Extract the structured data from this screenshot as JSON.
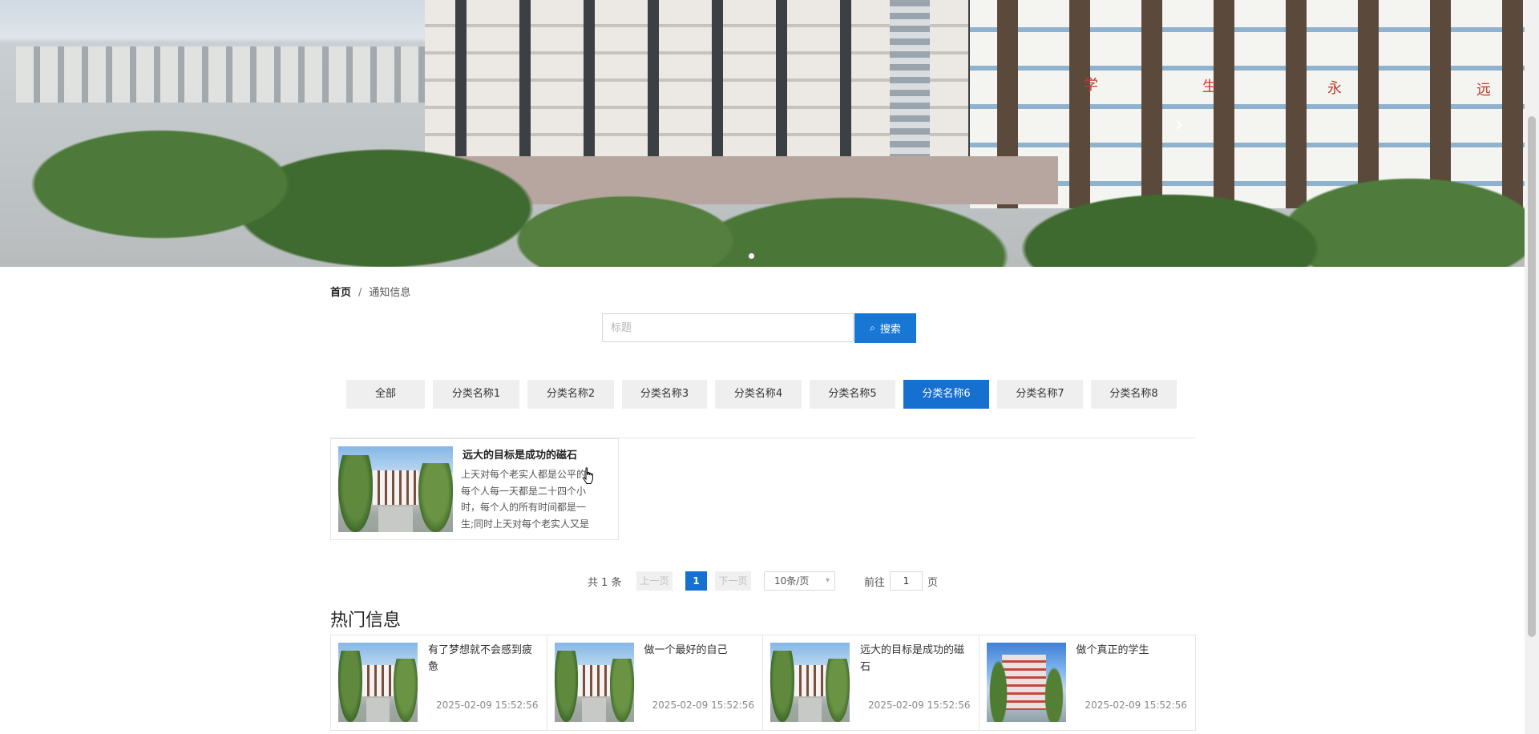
{
  "banner": {
    "sign_chars": [
      "学",
      "生",
      "永",
      "远"
    ],
    "next_arrow": "›"
  },
  "breadcrumb": {
    "home": "首页",
    "separator": "/",
    "current": "通知信息"
  },
  "search": {
    "placeholder": "标题",
    "value": "",
    "button_icon": "⌕",
    "button_label": "搜索"
  },
  "categories": [
    {
      "label": "全部",
      "active": false
    },
    {
      "label": "分类名称1",
      "active": false
    },
    {
      "label": "分类名称2",
      "active": false
    },
    {
      "label": "分类名称3",
      "active": false
    },
    {
      "label": "分类名称4",
      "active": false
    },
    {
      "label": "分类名称5",
      "active": false
    },
    {
      "label": "分类名称6",
      "active": true
    },
    {
      "label": "分类名称7",
      "active": false
    },
    {
      "label": "分类名称8",
      "active": false
    }
  ],
  "articles": [
    {
      "title": "远大的目标是成功的磁石",
      "summary": "上天对每个老实人都是公平的。每个人每一天都是二十四个小时，每个人的所有时间都是一生;同时上天对每个老实人又是"
    }
  ],
  "pagination": {
    "total": "共 1 条",
    "prev": "上一页",
    "current_page": "1",
    "next": "下一页",
    "page_size": "10条/页",
    "goto_label": "前往",
    "goto_value": "1",
    "goto_unit": "页"
  },
  "hot": {
    "title": "热门信息",
    "items": [
      {
        "title": "有了梦想就不会感到疲惫",
        "date": "2025-02-09 15:52:56",
        "image": "campus"
      },
      {
        "title": "做一个最好的自己",
        "date": "2025-02-09 15:52:56",
        "image": "campus"
      },
      {
        "title": "远大的目标是成功的磁石",
        "date": "2025-02-09 15:52:56",
        "image": "campus"
      },
      {
        "title": "做个真正的学生",
        "date": "2025-02-09 15:52:56",
        "image": "red-building"
      }
    ]
  },
  "colors": {
    "primary": "#1670d0",
    "category_bg": "#efefef",
    "border": "#e5e5e5"
  }
}
